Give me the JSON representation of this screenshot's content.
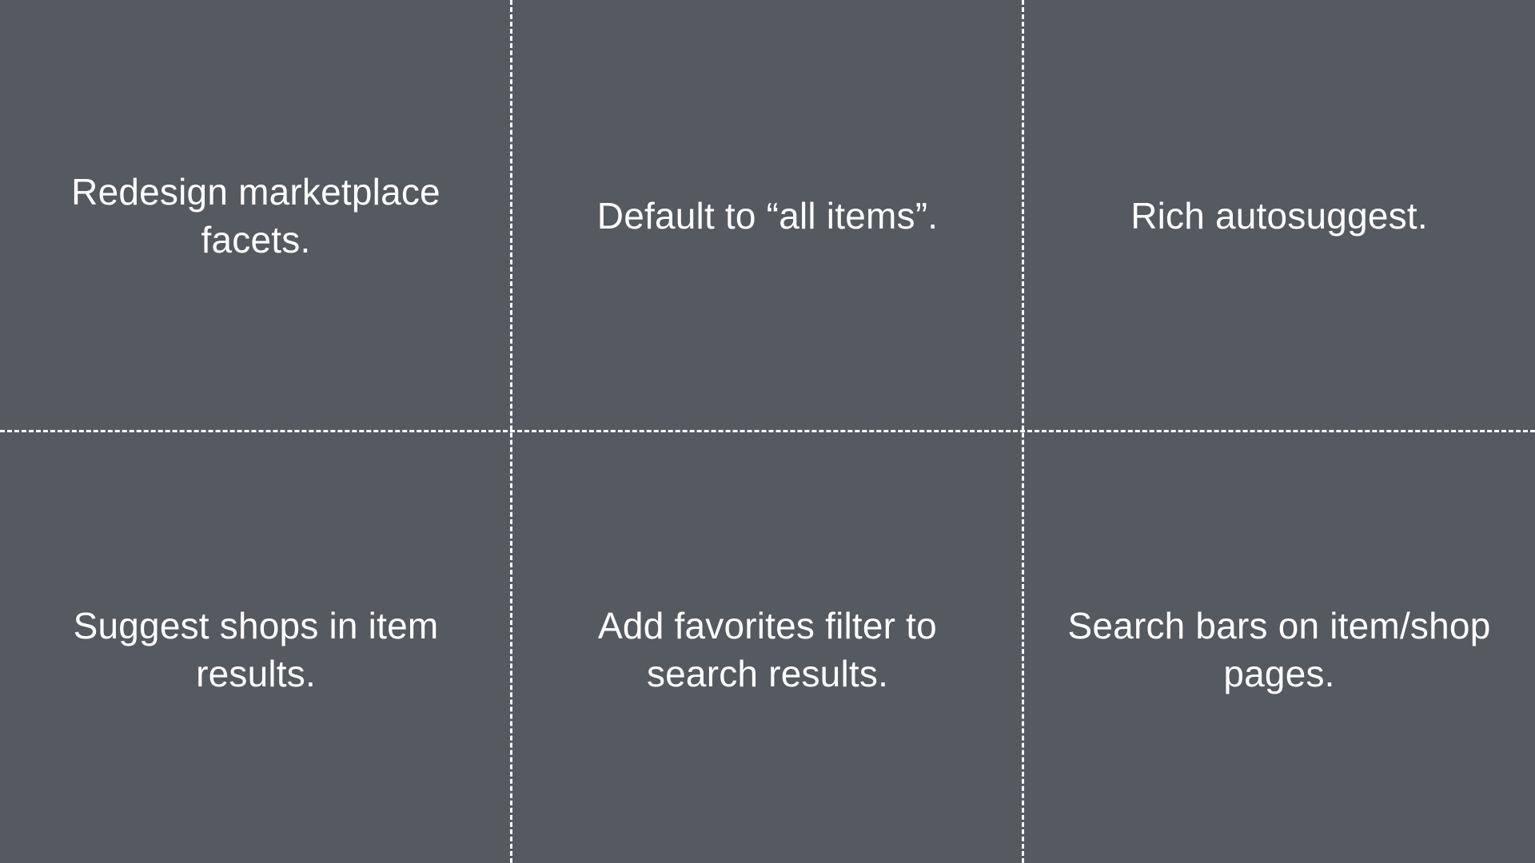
{
  "colors": {
    "background": "#555960",
    "text": "#ffffff",
    "divider": "#ffffff"
  },
  "cells": [
    {
      "text": "Redesign marketplace facets."
    },
    {
      "text": "Default to “all items”."
    },
    {
      "text": "Rich autosuggest."
    },
    {
      "text": "Suggest shops in item results."
    },
    {
      "text": "Add favorites filter to search results."
    },
    {
      "text": "Search bars on item/shop pages."
    }
  ]
}
